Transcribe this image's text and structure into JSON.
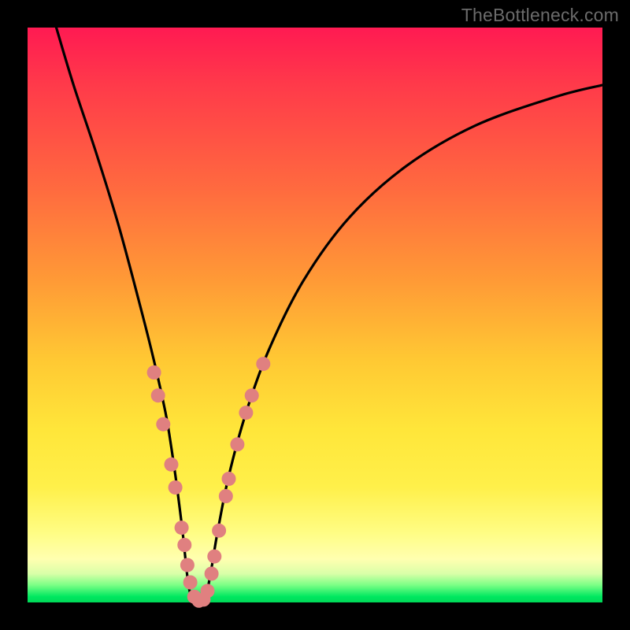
{
  "watermark": "TheBottleneck.com",
  "chart_data": {
    "type": "line",
    "title": "",
    "xlabel": "",
    "ylabel": "",
    "xlim": [
      0,
      100
    ],
    "ylim": [
      0,
      100
    ],
    "background_gradient": {
      "top": "#ff1a52",
      "middle": "#ffe63a",
      "bottom": "#00d858"
    },
    "series": [
      {
        "name": "bottleneck-curve",
        "color": "#000000",
        "x": [
          5,
          8,
          12,
          16,
          20,
          22,
          24,
          25,
          26,
          27,
          28,
          29,
          30,
          31,
          32,
          33,
          35,
          38,
          42,
          48,
          56,
          66,
          78,
          92,
          100
        ],
        "y": [
          100,
          90,
          78,
          65,
          50,
          42,
          33,
          27,
          20,
          12,
          3,
          0,
          0,
          1,
          6,
          12,
          22,
          33,
          44,
          56,
          67,
          76,
          83,
          88,
          90
        ]
      }
    ],
    "markers": {
      "name": "highlight-dots",
      "color": "#e08080",
      "radius": 9,
      "points": [
        {
          "x": 22.0,
          "y": 40
        },
        {
          "x": 22.7,
          "y": 36
        },
        {
          "x": 23.6,
          "y": 31
        },
        {
          "x": 25.0,
          "y": 24
        },
        {
          "x": 25.7,
          "y": 20
        },
        {
          "x": 26.8,
          "y": 13
        },
        {
          "x": 27.3,
          "y": 10
        },
        {
          "x": 27.8,
          "y": 6.5
        },
        {
          "x": 28.3,
          "y": 3.5
        },
        {
          "x": 29.0,
          "y": 1.0
        },
        {
          "x": 29.8,
          "y": 0.3
        },
        {
          "x": 30.6,
          "y": 0.5
        },
        {
          "x": 31.3,
          "y": 2.0
        },
        {
          "x": 32.0,
          "y": 5.0
        },
        {
          "x": 32.5,
          "y": 8.0
        },
        {
          "x": 33.3,
          "y": 12.5
        },
        {
          "x": 34.5,
          "y": 18.5
        },
        {
          "x": 35.0,
          "y": 21.5
        },
        {
          "x": 36.5,
          "y": 27.5
        },
        {
          "x": 38.0,
          "y": 33.0
        },
        {
          "x": 39.0,
          "y": 36.0
        },
        {
          "x": 41.0,
          "y": 41.5
        }
      ]
    }
  }
}
